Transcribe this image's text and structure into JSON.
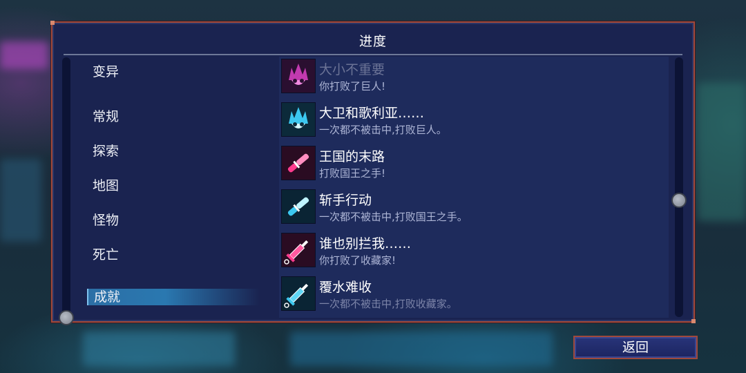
{
  "panel": {
    "title": "进度"
  },
  "categories": [
    {
      "label": "变异",
      "active": false
    },
    {
      "label": "常规",
      "active": false
    },
    {
      "label": "探索",
      "active": false
    },
    {
      "label": "地图",
      "active": false
    },
    {
      "label": "怪物",
      "active": false
    },
    {
      "label": "死亡",
      "active": false
    },
    {
      "label": "成就",
      "active": true
    }
  ],
  "achievements": [
    {
      "title": "大小不重要",
      "desc": "你打败了巨人!",
      "icon": "giant-skull-pink-icon",
      "color": "#e84cc8"
    },
    {
      "title": "大卫和歌利亚……",
      "desc": "一次都不被击中,打败巨人。",
      "icon": "giant-skull-cyan-icon",
      "color": "#4fe3ff"
    },
    {
      "title": "王国的末路",
      "desc": "打败国王之手!",
      "icon": "hand-pink-icon",
      "color": "#ff3c8e"
    },
    {
      "title": "斩手行动",
      "desc": "一次都不被击中,打败国王之手。",
      "icon": "hand-cyan-icon",
      "color": "#4fe3ff"
    },
    {
      "title": "谁也别拦我……",
      "desc": "你打败了收藏家!",
      "icon": "syringe-pink-icon",
      "color": "#ff3c8e"
    },
    {
      "title": "覆水难收",
      "desc": "一次都不被击中,打败收藏家。",
      "icon": "syringe-cyan-icon",
      "color": "#4fe3ff"
    }
  ],
  "footer": {
    "back_label": "返回"
  }
}
